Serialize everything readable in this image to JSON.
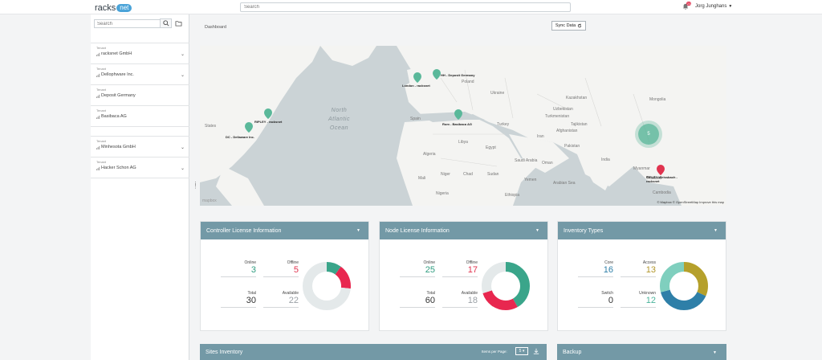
{
  "app": {
    "logo_text": "racks",
    "logo_cloud": "net"
  },
  "top_search": {
    "placeholder": "Search"
  },
  "user": {
    "name": "Jorg Junghans",
    "notifications": "23"
  },
  "sidebar": {
    "search_placeholder": "Search",
    "tenant_label": "Tenant",
    "tenants": [
      {
        "name": "racksnet GmbH",
        "expandable": true
      },
      {
        "name": "Dellophware Inc.",
        "expandable": true
      },
      {
        "name": "Deposit Germany",
        "expandable": false
      },
      {
        "name": "Basibaca AG",
        "expandable": false
      },
      {
        "name": "Minhesota GmbH",
        "expandable": true
      },
      {
        "name": "Hacker Schon AG",
        "expandable": true
      }
    ]
  },
  "breadcrumb": "Dashboard",
  "sync_button": "Sync Data",
  "map": {
    "ocean": [
      "North",
      "Atlantic",
      "Ocean"
    ],
    "cluster_count": "5",
    "attribution": "© Mapbox © OpenStreetMap Improve this map",
    "mapbox_logo": "mapbox",
    "markers": [
      {
        "label": "RIPLEY - racksnet",
        "color": "#5ab89a"
      },
      {
        "label": "DC - Dellaware Inc.",
        "color": "#5ab89a"
      },
      {
        "label": "London - racksnet",
        "color": "#5ab89a"
      },
      {
        "label": "HH - Deposit Germany",
        "color": "#5ab89a"
      },
      {
        "label": "Rom - Basibaca AG",
        "color": "#5ab89a"
      },
      {
        "label": "RIPLEY-Weissbach - racksnet",
        "color": "#e0334f"
      }
    ],
    "places": [
      "States",
      "Poland",
      "Ukraine",
      "Kazakhstan",
      "Mongolia",
      "Turkey",
      "Iran",
      "Egypt",
      "Saudi Arabia",
      "Libya",
      "Algeria",
      "Mali",
      "Niger",
      "Chad",
      "Sudan",
      "Nigeria",
      "Ethiopia",
      "Spain",
      "Turkmenistan",
      "Tajikistan",
      "Afghanistan",
      "Pakistan",
      "India",
      "Arabian Sea",
      "Myanmar",
      "Thailand",
      "Cambodia",
      "Uzbekistan",
      "Oman",
      "Yemen"
    ]
  },
  "cards": [
    {
      "title": "Controller License Information",
      "stats": [
        {
          "label": "Online",
          "value": "3",
          "color": "#2e9c7f"
        },
        {
          "label": "Offline",
          "value": "5",
          "color": "#e0334f"
        },
        {
          "label": "Total",
          "value": "30",
          "color": "#333333"
        },
        {
          "label": "Available",
          "value": "22",
          "color": "#9aa0a5"
        }
      ],
      "donut": [
        {
          "value": 3,
          "color": "#3aa58a"
        },
        {
          "value": 5,
          "color": "#e8274f"
        },
        {
          "value": 22,
          "color": "#e4e9ea"
        }
      ]
    },
    {
      "title": "Node License Information",
      "stats": [
        {
          "label": "Online",
          "value": "25",
          "color": "#2e9c7f"
        },
        {
          "label": "Offline",
          "value": "17",
          "color": "#e0334f"
        },
        {
          "label": "Total",
          "value": "60",
          "color": "#333333"
        },
        {
          "label": "Available",
          "value": "18",
          "color": "#9aa0a5"
        }
      ],
      "donut": [
        {
          "value": 25,
          "color": "#3aa58a"
        },
        {
          "value": 17,
          "color": "#e8274f"
        },
        {
          "value": 18,
          "color": "#e4e9ea"
        }
      ]
    },
    {
      "title": "Inventory Types",
      "stats": [
        {
          "label": "Core",
          "value": "16",
          "color": "#2e7fa8"
        },
        {
          "label": "Access",
          "value": "13",
          "color": "#b2962a"
        },
        {
          "label": "Switch",
          "value": "0",
          "color": "#333333"
        },
        {
          "label": "Unknown",
          "value": "12",
          "color": "#4ab39b"
        }
      ],
      "donut": [
        {
          "value": 13,
          "color": "#b5a02b"
        },
        {
          "value": 16,
          "color": "#2e7fa8"
        },
        {
          "value": 12,
          "color": "#7fcfbe"
        }
      ]
    }
  ],
  "bottom": {
    "sites_title": "Sites Inventory",
    "items_per_page_label": "Items per Page:",
    "items_per_page_value": "5",
    "backup_title": "Backup"
  },
  "colors": {
    "header": "#7399a6",
    "online": "#2e9c7f",
    "offline": "#e0334f"
  }
}
